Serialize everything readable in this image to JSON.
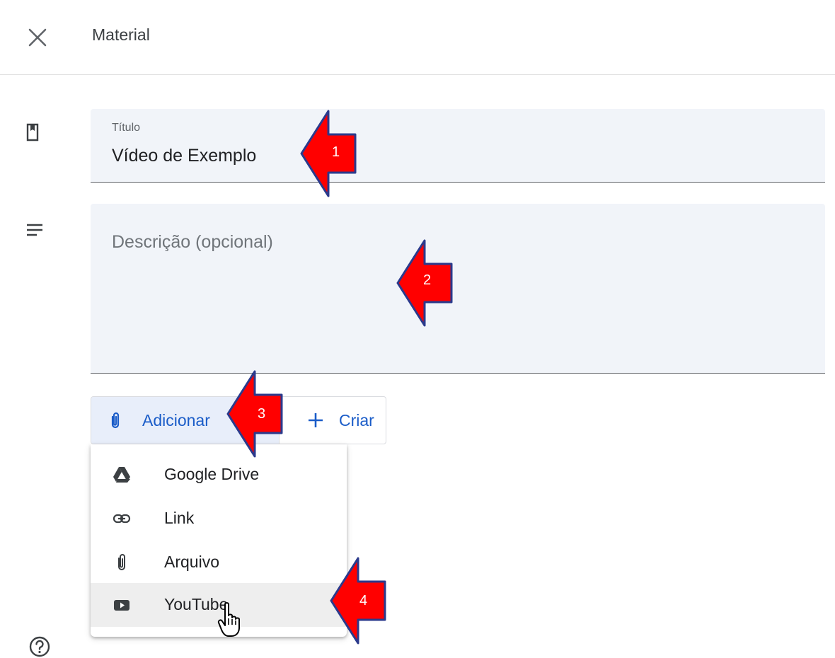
{
  "header": {
    "title": "Material",
    "close_icon": "close-icon"
  },
  "form": {
    "title_field": {
      "label": "Título",
      "value": "Vídeo de Exemplo",
      "icon": "book-icon"
    },
    "description_field": {
      "placeholder": "Descrição (opcional)",
      "icon": "notes-icon"
    }
  },
  "toolbar": {
    "add_label": "Adicionar",
    "add_icon": "paperclip-icon",
    "create_label": "Criar",
    "create_icon": "plus-icon"
  },
  "attach_menu": {
    "items": [
      {
        "label": "Google Drive",
        "icon": "google-drive-icon",
        "active": false
      },
      {
        "label": "Link",
        "icon": "link-icon",
        "active": false
      },
      {
        "label": "Arquivo",
        "icon": "paperclip-icon",
        "active": false
      },
      {
        "label": "YouTube",
        "icon": "youtube-icon",
        "active": true
      }
    ]
  },
  "callouts": [
    "1",
    "2",
    "3",
    "4"
  ],
  "colors": {
    "accent": "#1a5cc8",
    "field_bg": "#f1f4f9",
    "callout_red": "#ff0000",
    "callout_border": "#2b3a8c"
  }
}
